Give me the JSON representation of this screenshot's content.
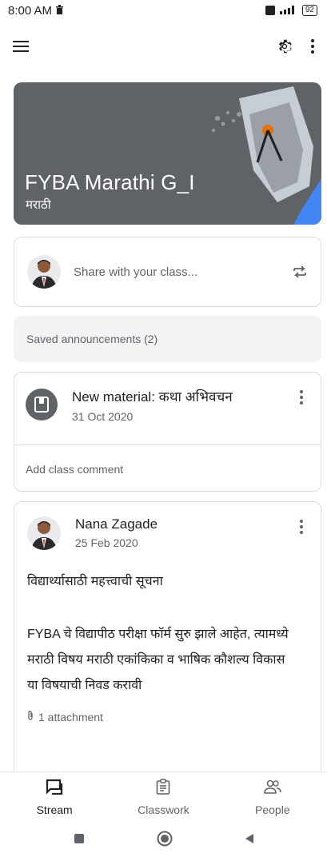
{
  "status_bar": {
    "time": "8:00 AM",
    "battery": "92"
  },
  "app_bar": {
    "menu_icon": "hamburger-menu-icon",
    "settings_icon": "gear-icon",
    "overflow_icon": "more-vert-icon"
  },
  "banner": {
    "title": "FYBA Marathi G_I",
    "subtitle": "मराठी"
  },
  "share": {
    "placeholder": "Share with your class..."
  },
  "saved_announcements": {
    "label": "Saved announcements (2)"
  },
  "material": {
    "title": "New material: कथा अभिवचन",
    "date": "31 Oct 2020",
    "comment_label": "Add class comment"
  },
  "post": {
    "author": "Nana Zagade",
    "date": "25 Feb 2020",
    "heading": "विद्यार्थ्यासाठी महत्त्वाची सूचना",
    "body_line1": "FYBA चे विद्यापीठ परीक्षा फॉर्म सुरु झाले आहेत, त्यामध्ये",
    "body_line2": "मराठी विषय मराठी एकांकिका व भाषिक कौशल्य विकास",
    "body_line3": "या विषयाची निवड करावी",
    "attachment_label": "1 attachment"
  },
  "bottom_nav": [
    {
      "label": "Stream",
      "icon": "stream-icon",
      "active": true
    },
    {
      "label": "Classwork",
      "icon": "classwork-icon",
      "active": false
    },
    {
      "label": "People",
      "icon": "people-icon",
      "active": false
    }
  ],
  "colors": {
    "banner_bg": "#5f6368",
    "text_primary": "#202124",
    "text_secondary": "#5f6368",
    "border": "#dadce0"
  }
}
